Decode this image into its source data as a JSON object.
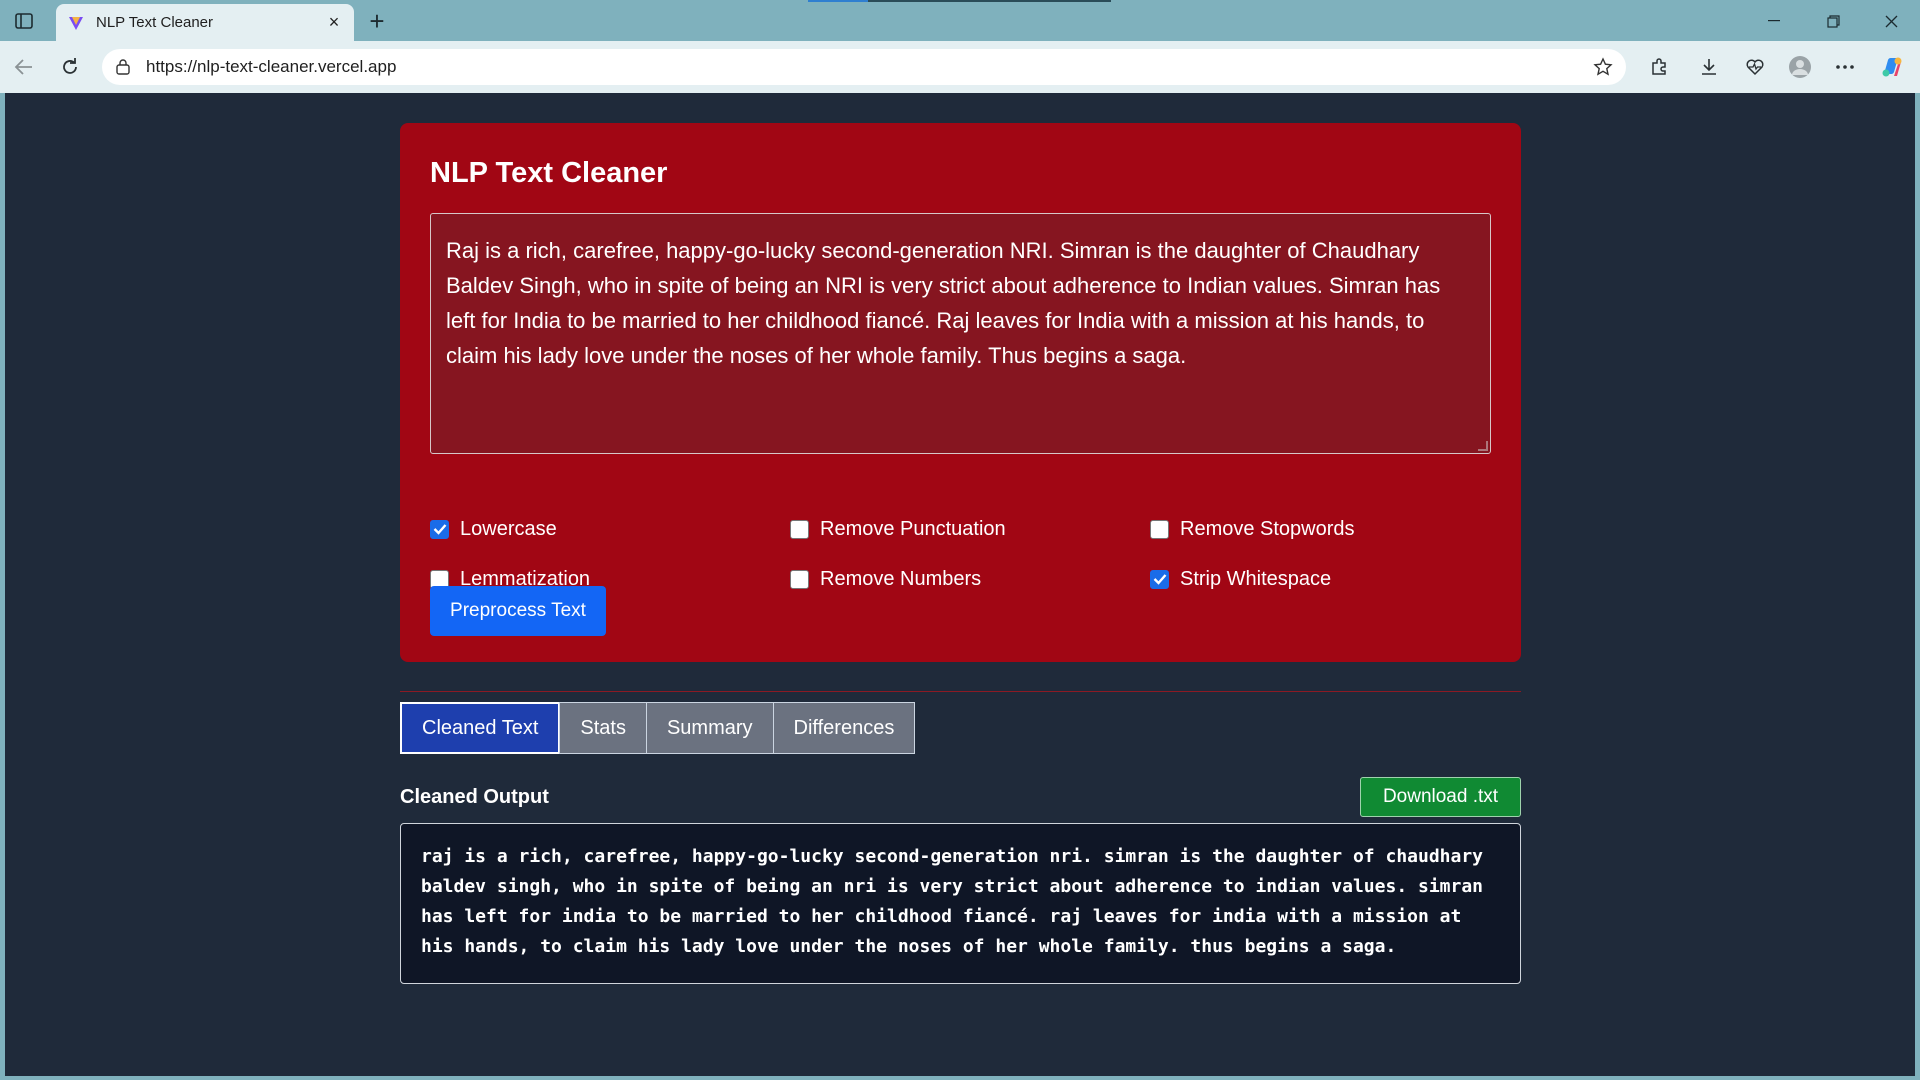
{
  "browser": {
    "tab_title": "NLP Text Cleaner",
    "url": "https://nlp-text-cleaner.vercel.app"
  },
  "app": {
    "title": "NLP Text Cleaner",
    "input_text": "Raj is a rich, carefree, happy-go-lucky second-generation NRI. Simran is the daughter of Chaudhary Baldev Singh, who in spite of being an NRI is very strict about adherence to Indian values. Simran has left for India to be married to her childhood fiancé. Raj leaves for India with a mission at his hands, to claim his lady love under the noses of her whole family. Thus begins a saga.",
    "options": [
      {
        "label": "Lowercase",
        "checked": true
      },
      {
        "label": "Remove Punctuation",
        "checked": false
      },
      {
        "label": "Remove Stopwords",
        "checked": false
      },
      {
        "label": "Lemmatization",
        "checked": false
      },
      {
        "label": "Remove Numbers",
        "checked": false
      },
      {
        "label": "Strip Whitespace",
        "checked": true
      }
    ],
    "preprocess_label": "Preprocess Text"
  },
  "results": {
    "tabs": [
      {
        "label": "Cleaned Text",
        "active": true
      },
      {
        "label": "Stats",
        "active": false
      },
      {
        "label": "Summary",
        "active": false
      },
      {
        "label": "Differences",
        "active": false
      }
    ],
    "output_title": "Cleaned Output",
    "download_label": "Download .txt",
    "output_text": "raj is a rich, carefree, happy-go-lucky second-generation nri. simran is the daughter of chaudhary baldev singh, who in spite of being an nri is very strict about adherence to indian values. simran has left for india to be married to her childhood fiancé. raj leaves for india with a mission at his hands, to claim his lady love under the noses of her whole family. thus begins a saga."
  },
  "colors": {
    "card": "#a10614",
    "page_bg": "#1f2a3a",
    "primary": "#1366f5",
    "active_tab": "#1e3fae",
    "download": "#108a33"
  }
}
